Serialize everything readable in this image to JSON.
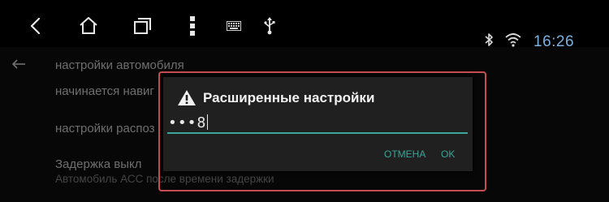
{
  "status_bar": {
    "time": "16:26",
    "icons": [
      "bluetooth-icon",
      "wifi-icon"
    ]
  },
  "nav_bar": {
    "buttons": [
      "back-icon",
      "home-icon",
      "recent-apps-icon",
      "menu-icon",
      "keyboard-icon",
      "usb-icon"
    ]
  },
  "settings_page": {
    "back_icon": "arrow-left-icon",
    "items": [
      {
        "title": "настройки автомобиля"
      },
      {
        "title": "начинается навиг"
      },
      {
        "title": "настройки распоз"
      },
      {
        "title": "Задержка выкл",
        "subtitle": "Автомобиль АСС после времени задержки"
      }
    ]
  },
  "dialog": {
    "title": "Расширенные настройки",
    "icon": "warning-icon",
    "password_display": "•••8",
    "cancel_label": "ОТМЕНА",
    "ok_label": "OK"
  },
  "colors": {
    "accent": "#3aa597",
    "clock": "#7ab0de",
    "highlight_frame": "#c64e52",
    "dialog_bg": "#202020"
  }
}
